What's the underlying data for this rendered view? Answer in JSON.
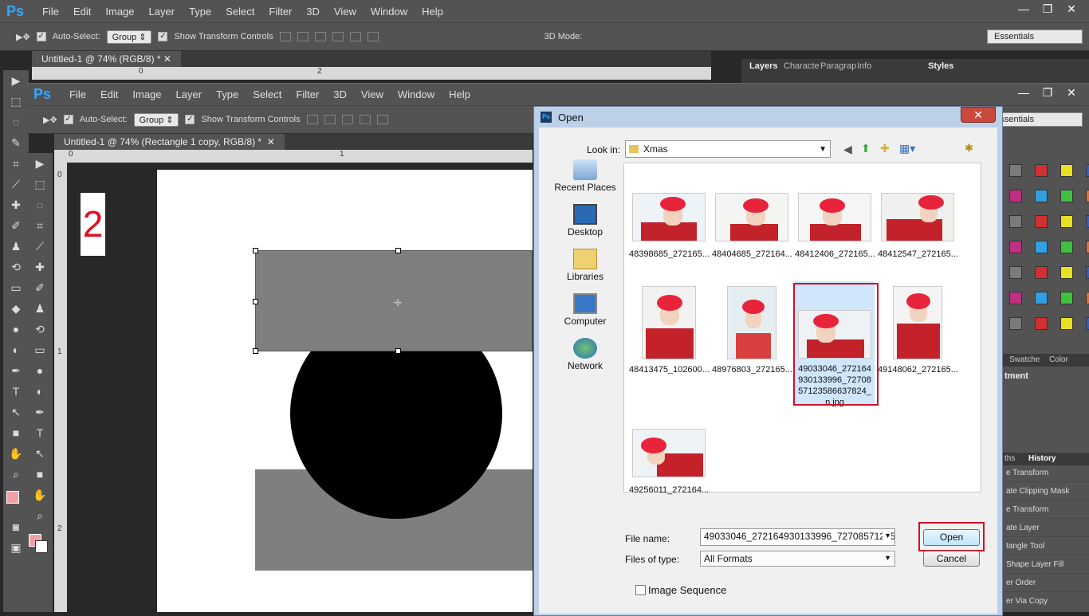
{
  "back_window": {
    "menu": [
      "File",
      "Edit",
      "Image",
      "Layer",
      "Type",
      "Select",
      "Filter",
      "3D",
      "View",
      "Window",
      "Help"
    ],
    "options": {
      "auto_select": "Auto-Select:",
      "group": "Group",
      "show_transform": "Show Transform Controls",
      "mode_3d": "3D Mode:"
    },
    "workspace": "Essentials",
    "doc_tab": "Untitled-1 @ 74% (RGB/8) *",
    "panel_tabs": [
      "Layers",
      "Characte",
      "Paragrap",
      "Info"
    ],
    "styles_tab": "Styles",
    "ruler_marks": [
      "0",
      "2"
    ]
  },
  "front_window": {
    "menu": [
      "File",
      "Edit",
      "Image",
      "Layer",
      "Type",
      "Select",
      "Filter",
      "3D",
      "View",
      "Window",
      "Help"
    ],
    "options": {
      "auto_select": "Auto-Select:",
      "group": "Group",
      "show_transform": "Show Transform Controls"
    },
    "workspace": "Essentials",
    "doc_tab": "Untitled-1 @ 74% (Rectangle 1 copy, RGB/8) *",
    "ruler_top": [
      "0",
      "1"
    ],
    "ruler_left": [
      "0",
      "1",
      "2"
    ],
    "canvas_label": "2",
    "right_panel": {
      "swatch_tabs": [
        "Swatche",
        "Color"
      ],
      "adjustments_title": "tment",
      "history_tabs": [
        "ths",
        "History"
      ],
      "history_items": [
        "e Transform",
        "ate Clipping Mask",
        "e Transform",
        "ate Layer",
        "tangle Tool",
        "Shape Layer Fill",
        "er Order",
        "er Via Copy"
      ]
    }
  },
  "dialog": {
    "title": "Open",
    "close": "✕",
    "look_in_label": "Look in:",
    "look_in_value": "Xmas",
    "places": [
      "Recent Places",
      "Desktop",
      "Libraries",
      "Computer",
      "Network"
    ],
    "files": [
      {
        "name": "48398685_272165..."
      },
      {
        "name": "48404685_272164..."
      },
      {
        "name": "48412406_272165..."
      },
      {
        "name": "48412547_272165..."
      },
      {
        "name": "48413475_102600..."
      },
      {
        "name": "48976803_272165..."
      },
      {
        "name": "49033046_272164930133996_7270857123586637824_n.jpg",
        "selected": true
      },
      {
        "name": "49148062_272165..."
      },
      {
        "name": "49256011_272164..."
      }
    ],
    "file_name_label": "File name:",
    "file_name_value": "49033046_272164930133996_727085712358",
    "files_of_type_label": "Files of type:",
    "files_of_type_value": "All Formats",
    "open_button": "Open",
    "cancel_button": "Cancel",
    "image_sequence": "Image Sequence"
  },
  "colors": {
    "ps_blue": "#31a8ff",
    "panel": "#535353",
    "highlight": "#d0102a",
    "hair": "#e8243a"
  }
}
